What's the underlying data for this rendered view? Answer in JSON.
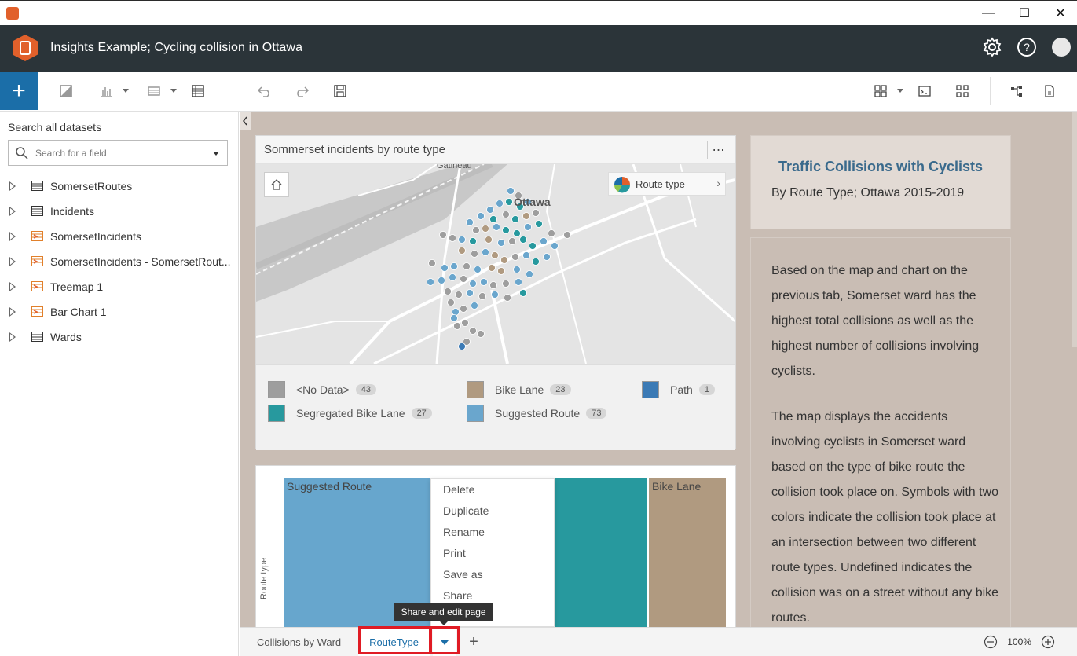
{
  "window": {
    "min": "—",
    "max": "☐",
    "close": "✕"
  },
  "header": {
    "title": "Insights Example; Cycling collision in Ottawa"
  },
  "toolbar": {
    "add_label": "+"
  },
  "datapane": {
    "title": "Search all datasets",
    "search_placeholder": "Search for a field",
    "datasets": [
      {
        "name": "SomersetRoutes",
        "icon": "table-icon"
      },
      {
        "name": "Incidents",
        "icon": "table-icon"
      },
      {
        "name": "SomersetIncidents",
        "icon": "result-icon"
      },
      {
        "name": "SomersetIncidents - SomersetRout...",
        "icon": "result-icon"
      },
      {
        "name": "Treemap 1",
        "icon": "result-icon"
      },
      {
        "name": "Bar Chart 1",
        "icon": "result-icon"
      },
      {
        "name": "Wards",
        "icon": "table-icon"
      }
    ]
  },
  "map_card": {
    "title": "Sommerset incidents by route type",
    "legend_button": "Route type",
    "city_label": "Ottawa",
    "top_label": "Gatineau",
    "legend": [
      {
        "label": "<No Data>",
        "count": "43",
        "color": "#9e9e9e"
      },
      {
        "label": "Bike Lane",
        "count": "23",
        "color": "#b09a80"
      },
      {
        "label": "Path",
        "count": "1",
        "color": "#3b7ab5"
      },
      {
        "label": "Segregated Bike Lane",
        "count": "27",
        "color": "#27999e"
      },
      {
        "label": "Suggested Route",
        "count": "73",
        "color": "#6aa6cd"
      }
    ]
  },
  "treemap": {
    "labels": {
      "suggested": "Suggested Route",
      "bike_lane": "Bike Lane"
    },
    "y_axis": "Route type",
    "colors": {
      "suggested": "#67a6cd",
      "segregated": "#27999e",
      "bike_lane": "#b09a80"
    }
  },
  "text_card": {
    "title": "Traffic Collisions with Cyclists",
    "subtitle": "By Route Type; Ottawa 2015-2019",
    "para1": "Based on the map and chart on the previous tab, Somerset ward has the highest total collisions as well as the highest number of collisions involving cyclists.",
    "para2": "The map displays the accidents involving cyclists in Somerset ward based on the type of bike route the collision took place on. Symbols with two colors indicate the collision took place at an intersection between two different route types. Undefined indicates the collision was on a street without any bike routes."
  },
  "context_menu": {
    "items": [
      "Delete",
      "Duplicate",
      "Rename",
      "Print",
      "Save as",
      "Share"
    ]
  },
  "tooltip": "Share and edit page",
  "tabs": {
    "page1": "Collisions by Ward",
    "page2": "RouteType",
    "add": "+"
  },
  "zoom": {
    "level": "100%"
  }
}
